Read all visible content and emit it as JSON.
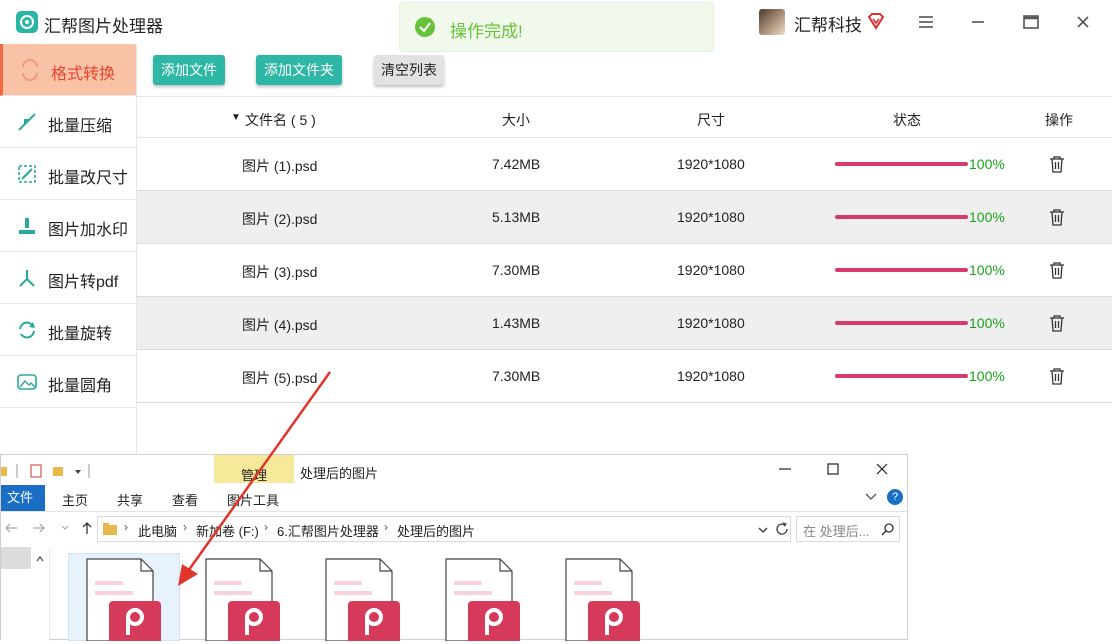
{
  "app": {
    "title": "汇帮图片处理器",
    "brand": "汇帮科技",
    "toast": "操作完成!"
  },
  "sidebar": {
    "items": [
      {
        "label": "格式转换",
        "icon": "format-convert-icon",
        "active": true
      },
      {
        "label": "批量压缩",
        "icon": "compress-icon",
        "active": false
      },
      {
        "label": "批量改尺寸",
        "icon": "resize-icon",
        "active": false
      },
      {
        "label": "图片加水印",
        "icon": "watermark-icon",
        "active": false
      },
      {
        "label": "图片转pdf",
        "icon": "pdf-icon",
        "active": false
      },
      {
        "label": "批量旋转",
        "icon": "rotate-icon",
        "active": false
      },
      {
        "label": "批量圆角",
        "icon": "round-corner-icon",
        "active": false
      }
    ]
  },
  "toolbar": {
    "add_file": "添加文件",
    "add_folder": "添加文件夹",
    "clear_list": "清空列表"
  },
  "table": {
    "headers": {
      "name": "文件名 ( 5 )",
      "size": "大小",
      "dimension": "尺寸",
      "status": "状态",
      "action": "操作"
    },
    "rows": [
      {
        "name": "图片 (1).psd",
        "size": "7.42MB",
        "dimension": "1920*1080",
        "progress": 1.0,
        "percent": "100%"
      },
      {
        "name": "图片 (2).psd",
        "size": "5.13MB",
        "dimension": "1920*1080",
        "progress": 1.0,
        "percent": "100%"
      },
      {
        "name": "图片 (3).psd",
        "size": "7.30MB",
        "dimension": "1920*1080",
        "progress": 1.0,
        "percent": "100%"
      },
      {
        "name": "图片 (4).psd",
        "size": "1.43MB",
        "dimension": "1920*1080",
        "progress": 1.0,
        "percent": "100%"
      },
      {
        "name": "图片 (5).psd",
        "size": "7.30MB",
        "dimension": "1920*1080",
        "progress": 1.0,
        "percent": "100%"
      }
    ]
  },
  "explorer": {
    "title": "处理后的图片",
    "manage_tab": "管理",
    "tabs": [
      "文件",
      "主页",
      "共享",
      "查看",
      "图片工具"
    ],
    "breadcrumb": [
      "此电脑",
      "新加卷 (F:)",
      "6.汇帮图片处理器",
      "处理后的图片"
    ],
    "search_placeholder": "在 处理后...",
    "file_count": 5
  },
  "colors": {
    "accent_teal": "#2db7a4",
    "active_nav_bg": "#f7c2a6",
    "active_nav_text": "#e8452d",
    "progress": "#d63a6e",
    "percent_text": "#1aa31a",
    "toast_green": "#67c23a"
  }
}
